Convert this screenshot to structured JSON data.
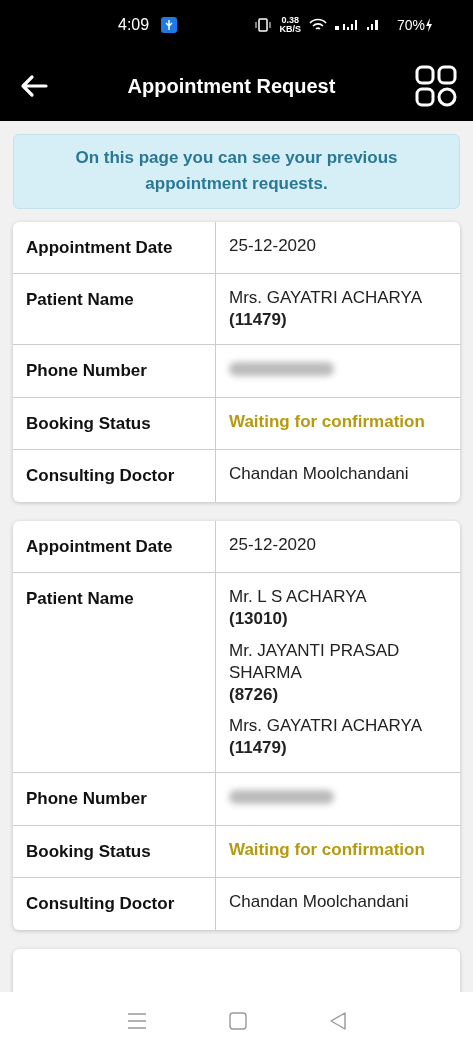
{
  "status_bar": {
    "time": "4:09",
    "speed": "0.38",
    "speed_unit": "KB/S",
    "battery": "70%"
  },
  "header": {
    "title": "Appointment Request"
  },
  "notice": "On this page you can see your previous appointment requests.",
  "appointments": [
    {
      "rows": [
        {
          "kind": "text",
          "label": "Appointment Date",
          "value": "25-12-2020"
        },
        {
          "kind": "patients",
          "label": "Patient Name",
          "patients": [
            {
              "name": "Mrs. GAYATRI ACHARYA",
              "id": "(11479)"
            }
          ]
        },
        {
          "kind": "redacted",
          "label": "Phone Number"
        },
        {
          "kind": "status",
          "label": "Booking Status",
          "value": "Waiting for confirmation"
        },
        {
          "kind": "text",
          "label": "Consulting Doctor",
          "value": "Chandan Moolchandani"
        }
      ]
    },
    {
      "rows": [
        {
          "kind": "text",
          "label": "Appointment Date",
          "value": "25-12-2020"
        },
        {
          "kind": "patients",
          "label": "Patient Name",
          "patients": [
            {
              "name": "Mr. L S ACHARYA",
              "id": "(13010)"
            },
            {
              "name": "Mr. JAYANTI PRASAD SHARMA",
              "id": "(8726)"
            },
            {
              "name": "Mrs. GAYATRI ACHARYA",
              "id": "(11479)"
            }
          ]
        },
        {
          "kind": "redacted",
          "label": "Phone Number"
        },
        {
          "kind": "status",
          "label": "Booking Status",
          "value": "Waiting for confirmation"
        },
        {
          "kind": "text",
          "label": "Consulting Doctor",
          "value": "Chandan Moolchandani"
        }
      ]
    },
    {
      "kind": "cut_off"
    }
  ]
}
